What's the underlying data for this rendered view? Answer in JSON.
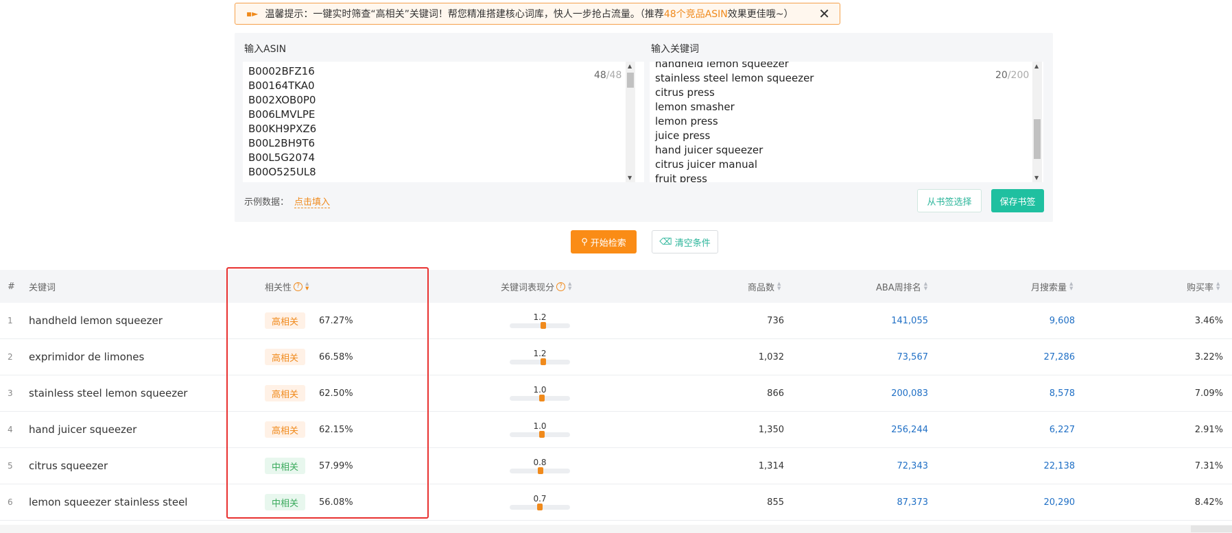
{
  "notice": {
    "prefix": "温馨提示：一键实时筛查“高相关”关键词！帮您精准搭建核心词库，快人一步抢占流量。（推荐",
    "highlight": "48个竞品ASIN",
    "suffix": "效果更佳哦~）",
    "speaker_icon": "megaphone-icon",
    "close_icon": "close-icon"
  },
  "asin_field": {
    "label": "输入ASIN",
    "lines": [
      "B0002BFZ16",
      "B00164TKA0",
      "B002XOB0P0",
      "B006LMVLPE",
      "B00KH9PXZ6",
      "B00L2BH9T6",
      "B00L5G2074",
      "B00O525UL8"
    ],
    "count": "48",
    "max": "/48"
  },
  "keyword_field": {
    "label": "输入关键词",
    "lines": [
      "handheld lemon squeezer",
      "stainless steel lemon squeezer",
      "citrus press",
      "lemon smasher",
      "lemon press",
      "juice press",
      "hand juicer squeezer",
      "citrus juicer manual",
      "fruit press"
    ],
    "count": "20",
    "max": "/200"
  },
  "sample": {
    "label": "示例数据：",
    "fill": "点击填入"
  },
  "buttons": {
    "from_bookmark": "从书签选择",
    "save_bookmark": "保存书签",
    "search": "开始检索",
    "clear": "清空条件"
  },
  "table": {
    "headers": {
      "index": "#",
      "keyword": "关键词",
      "relevance": "相关性",
      "score": "关键词表现分",
      "products": "商品数",
      "aba": "ABA周排名",
      "monthly": "月搜索量",
      "purchase": "购买率"
    },
    "rows": [
      {
        "index": "1",
        "keyword": "handheld lemon squeezer",
        "tag": "高相关",
        "tag_type": "high",
        "pct": "67.27%",
        "score": "1.2",
        "score_value": 1.2,
        "products": "736",
        "aba": "141,055",
        "monthly": "9,608",
        "purchase": "3.46%"
      },
      {
        "index": "2",
        "keyword": "exprimidor de limones",
        "tag": "高相关",
        "tag_type": "high",
        "pct": "66.58%",
        "score": "1.2",
        "score_value": 1.2,
        "products": "1,032",
        "aba": "73,567",
        "monthly": "27,286",
        "purchase": "3.22%"
      },
      {
        "index": "3",
        "keyword": "stainless steel lemon squeezer",
        "tag": "高相关",
        "tag_type": "high",
        "pct": "62.50%",
        "score": "1.0",
        "score_value": 1.0,
        "products": "866",
        "aba": "200,083",
        "monthly": "8,578",
        "purchase": "7.09%"
      },
      {
        "index": "4",
        "keyword": "hand juicer squeezer",
        "tag": "高相关",
        "tag_type": "high",
        "pct": "62.15%",
        "score": "1.0",
        "score_value": 1.0,
        "products": "1,350",
        "aba": "256,244",
        "monthly": "6,227",
        "purchase": "2.91%"
      },
      {
        "index": "5",
        "keyword": "citrus squeezer",
        "tag": "中相关",
        "tag_type": "mid",
        "pct": "57.99%",
        "score": "0.8",
        "score_value": 0.8,
        "products": "1,314",
        "aba": "72,343",
        "monthly": "22,138",
        "purchase": "7.31%"
      },
      {
        "index": "6",
        "keyword": "lemon squeezer stainless steel",
        "tag": "中相关",
        "tag_type": "mid",
        "pct": "56.08%",
        "score": "0.7",
        "score_value": 0.7,
        "products": "855",
        "aba": "87,373",
        "monthly": "20,290",
        "purchase": "8.42%"
      }
    ]
  },
  "colors": {
    "accent_orange": "#fa8c16",
    "teal": "#1fc0a0",
    "link_blue": "#1f6fc5",
    "highlight_red": "#e8302f"
  }
}
